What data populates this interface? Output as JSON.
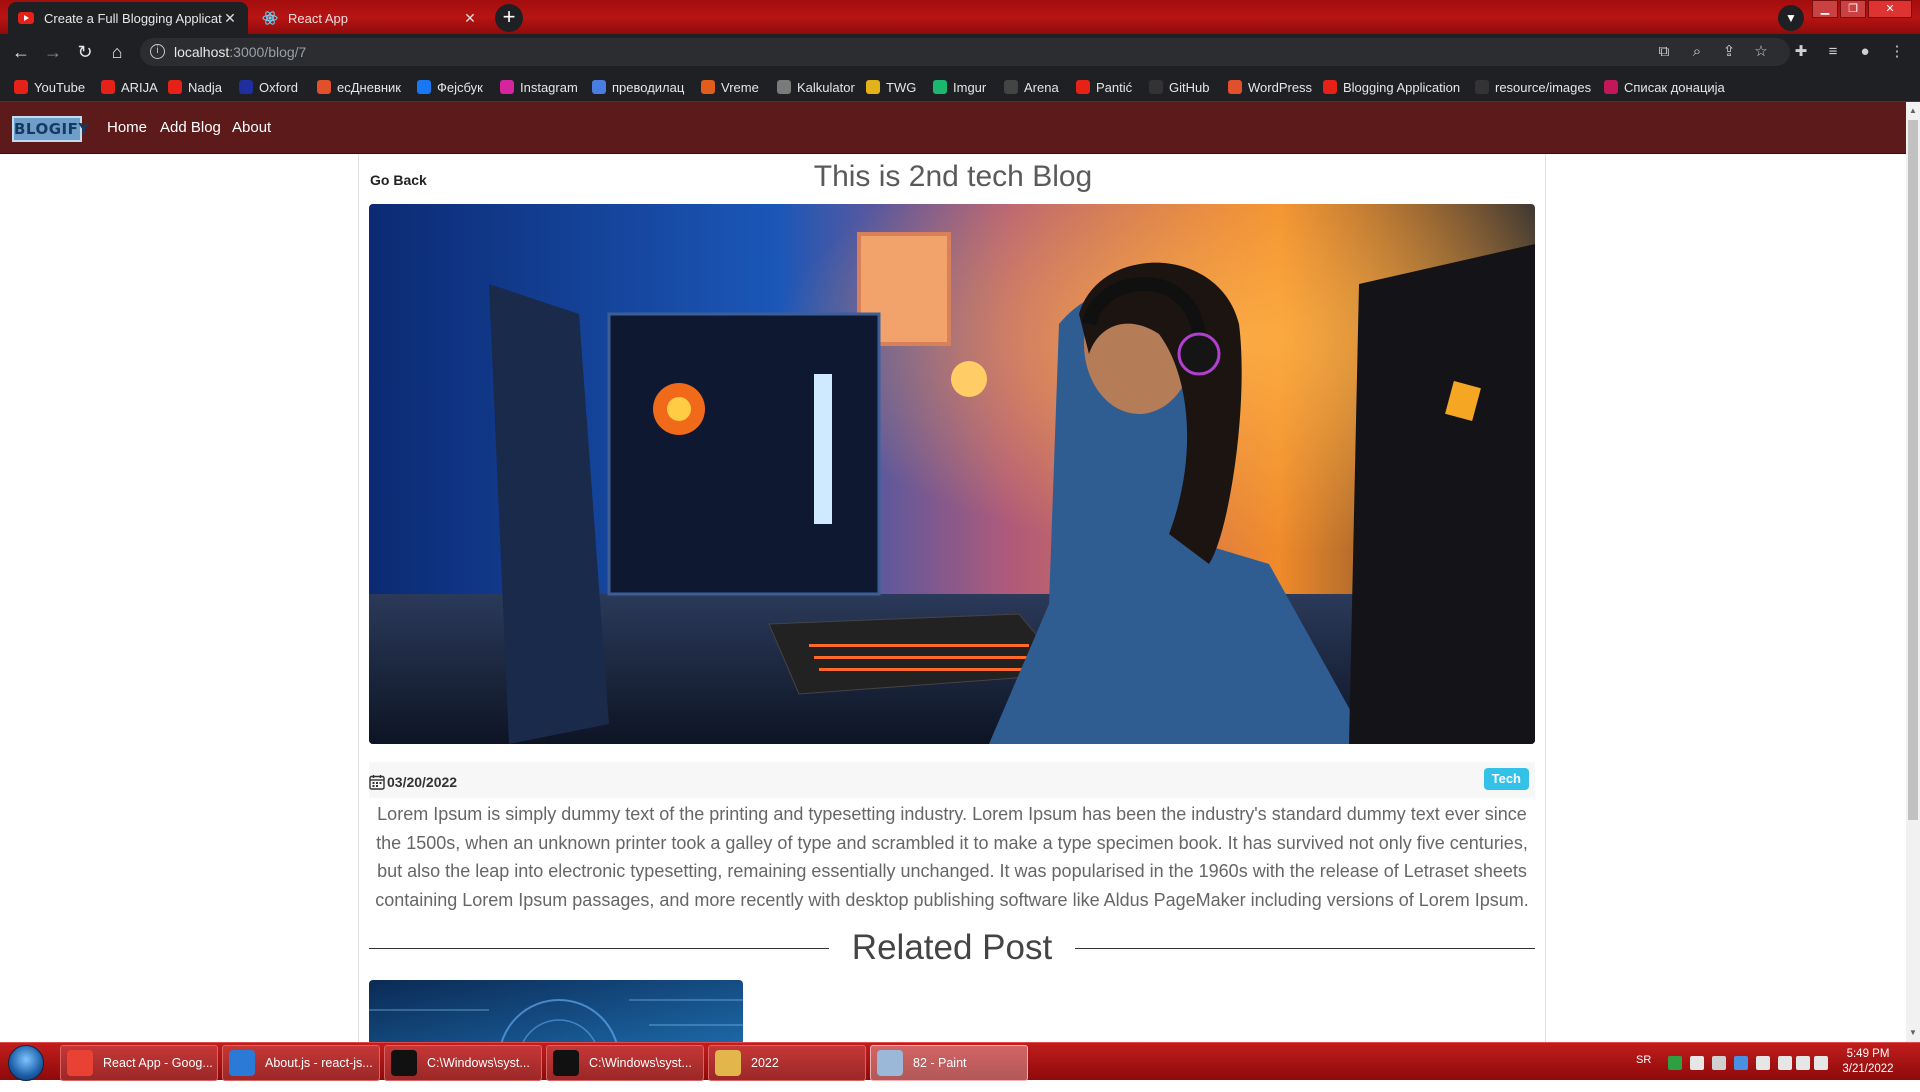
{
  "browser": {
    "tabs": [
      {
        "title": "Create a Full Blogging Applicatio",
        "active": true
      },
      {
        "title": "React App",
        "active": false
      }
    ],
    "url_host": "localhost",
    "url_path": ":3000/blog/7",
    "bookmarks": [
      {
        "label": "YouTube",
        "color": "#e62117"
      },
      {
        "label": "ARIJA",
        "color": "#e62117"
      },
      {
        "label": "Nadja",
        "color": "#e62117"
      },
      {
        "label": "Oxford",
        "color": "#1e2fa0"
      },
      {
        "label": "есДневник",
        "color": "#e0502b"
      },
      {
        "label": "Фејсбук",
        "color": "#1877f2"
      },
      {
        "label": "Instagram",
        "color": "#d6249f"
      },
      {
        "label": "преводилац",
        "color": "#4a7de2"
      },
      {
        "label": "Vreme",
        "color": "#e25c1b"
      },
      {
        "label": "Kalkulator",
        "color": "#7a7a7a"
      },
      {
        "label": "TWG",
        "color": "#e3b21a"
      },
      {
        "label": "Imgur",
        "color": "#1bb76e"
      },
      {
        "label": "Arena",
        "color": "#444444"
      },
      {
        "label": "Pantić",
        "color": "#e62117"
      },
      {
        "label": "GitHub",
        "color": "#333333"
      },
      {
        "label": "WordPress",
        "color": "#e0502b"
      },
      {
        "label": "Blogging Application",
        "color": "#e62117"
      },
      {
        "label": "resource/images",
        "color": "#333333"
      },
      {
        "label": "Списак донација",
        "color": "#c2185b"
      }
    ]
  },
  "app": {
    "logo": "BLOGIFY",
    "nav": [
      "Home",
      "Add Blog",
      "About"
    ]
  },
  "blog": {
    "go_back": "Go Back",
    "title": "This is 2nd tech Blog",
    "date": "03/20/2022",
    "category": "Tech",
    "description": "Lorem Ipsum is simply dummy text of the printing and typesetting industry. Lorem Ipsum has been the industry's standard dummy text ever since the 1500s, when an unknown printer took a galley of type and scrambled it to make a type specimen book. It has survived not only five centuries, but also the leap into electronic typesetting, remaining essentially unchanged. It was popularised in the 1960s with the release of Letraset sheets containing Lorem Ipsum passages, and more recently with desktop publishing software like Aldus PageMaker including versions of Lorem Ipsum.",
    "related_heading": "Related Post"
  },
  "taskbar": {
    "tasks": [
      {
        "label": "React App - Goog...",
        "active": false
      },
      {
        "label": "About.js - react-js...",
        "active": false
      },
      {
        "label": "C:\\Windows\\syst...",
        "active": false
      },
      {
        "label": "C:\\Windows\\syst...",
        "active": false
      },
      {
        "label": "2022",
        "active": false
      },
      {
        "label": "82 - Paint",
        "active": true
      }
    ],
    "language": "SR",
    "time": "5:49 PM",
    "date": "3/21/2022"
  },
  "colors": {
    "app_nav": "#5c1a1a",
    "badge": "#33c1e8",
    "browser_frame": "#b81414"
  }
}
